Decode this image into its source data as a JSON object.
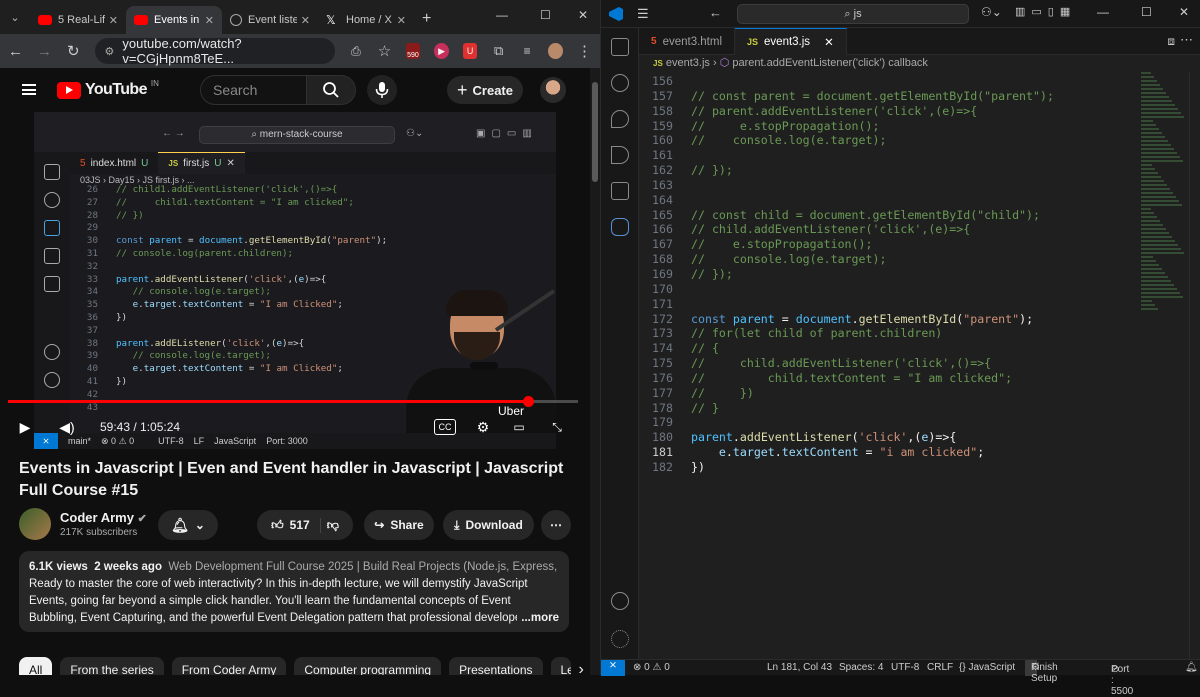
{
  "browser": {
    "tabs": [
      {
        "label": "5 Real-Life",
        "icon": "youtube-icon",
        "active": false
      },
      {
        "label": "Events in J",
        "icon": "youtube-icon",
        "active": true
      },
      {
        "label": "Event lister",
        "icon": "globe-icon",
        "active": false
      },
      {
        "label": "Home / X",
        "icon": "x-icon",
        "active": false
      }
    ],
    "url": "youtube.com/watch?v=CGjHpnm8TeE...",
    "badge_count": "590"
  },
  "youtube": {
    "logo_text": "YouTube",
    "country_code": "IN",
    "search_placeholder": "Search",
    "create_label": "Create",
    "video": {
      "editor_search": "mern-stack-course",
      "tabs": [
        {
          "label": "index.html",
          "flag": "U"
        },
        {
          "label": "first.js",
          "flag": "U"
        }
      ],
      "breadcrumb": "03JS  ›  Day15  ›  JS first.js  ›  ...",
      "code_lines": [
        {
          "n": "26",
          "code": "// child1.addEventListener('click',()=>{"
        },
        {
          "n": "27",
          "code": "//     child1.textContent = \"I am clicked\";"
        },
        {
          "n": "28",
          "code": "// })"
        },
        {
          "n": "29",
          "code": ""
        },
        {
          "n": "30",
          "code": "const parent = document.getElementById(\"parent\");"
        },
        {
          "n": "31",
          "code": "// console.log(parent.children);"
        },
        {
          "n": "32",
          "code": ""
        },
        {
          "n": "33",
          "code": "parent.addEventListener('click',(e)=>{"
        },
        {
          "n": "34",
          "code": "   // console.log(e.target);"
        },
        {
          "n": "35",
          "code": "   e.target.textContent = \"I am Clicked\";"
        },
        {
          "n": "36",
          "code": "})"
        },
        {
          "n": "37",
          "code": ""
        },
        {
          "n": "38",
          "code": "parent.addEListener('click',(e)=>{"
        },
        {
          "n": "39",
          "code": "   // console.log(e.target);"
        },
        {
          "n": "40",
          "code": "   e.target.textContent = \"I am Clicked\";"
        },
        {
          "n": "41",
          "code": "})"
        },
        {
          "n": "42",
          "code": ""
        },
        {
          "n": "43",
          "code": ""
        }
      ],
      "overlay_text": "Uber",
      "time": "59:43 / 1:05:24",
      "progress": 0.913,
      "status": {
        "branch": "main*",
        "problems": "⊗ 0 ⚠ 0",
        "encoding": "UTF-8",
        "eol": "LF",
        "language": "JavaScript",
        "port": "Port: 3000"
      }
    },
    "title": "Events in Javascript | Even and Event handler in Javascript | Javascript Full Course #15",
    "channel": {
      "name": "Coder Army",
      "subscribers": "217K subscribers"
    },
    "actions": {
      "likes": "517",
      "share": "Share",
      "download": "Download"
    },
    "description": {
      "views": "6.1K views",
      "age": "2 weeks ago",
      "tags": "Web Development Full Course 2025 | Build Real Projects (Node.js, Express, React, J",
      "text": "Ready to master the core of web interactivity? In this in-depth lecture, we will demystify JavaScript Events, going far beyond a simple click handler. You'll learn the fundamental concepts of Event Bubbling, Event Capturing, and the powerful Event Delegation pattern that professional developers use to write efficien",
      "more": "...more"
    },
    "chips": [
      "All",
      "From the series",
      "From Coder Army",
      "Computer programming",
      "Presentations",
      "Le"
    ]
  },
  "vscode": {
    "search": "js",
    "tabs": [
      {
        "label": "event3.html",
        "active": false
      },
      {
        "label": "event3.js",
        "active": true
      }
    ],
    "breadcrumb_file": "event3.js",
    "breadcrumb_symbol": "parent.addEventListener('click') callback",
    "current_line": "181",
    "lines": [
      {
        "n": "156",
        "code": ""
      },
      {
        "n": "157",
        "code": "// const parent = document.getElementById(\"parent\");"
      },
      {
        "n": "158",
        "code": "// parent.addEventListener('click',(e)=>{"
      },
      {
        "n": "159",
        "code": "//     e.stopPropagation();"
      },
      {
        "n": "160",
        "code": "//    console.log(e.target);"
      },
      {
        "n": "161",
        "code": ""
      },
      {
        "n": "162",
        "code": "// });"
      },
      {
        "n": "163",
        "code": ""
      },
      {
        "n": "164",
        "code": ""
      },
      {
        "n": "165",
        "code": "// const child = document.getElementById(\"child\");"
      },
      {
        "n": "166",
        "code": "// child.addEventListener('click',(e)=>{"
      },
      {
        "n": "167",
        "code": "//    e.stopPropagation();"
      },
      {
        "n": "168",
        "code": "//    console.log(e.target);"
      },
      {
        "n": "169",
        "code": "// });"
      },
      {
        "n": "170",
        "code": ""
      },
      {
        "n": "171",
        "code": ""
      },
      {
        "n": "172",
        "code": "const parent = document.getElementById(\"parent\");"
      },
      {
        "n": "173",
        "code": "// for(let child of parent.children)"
      },
      {
        "n": "174",
        "code": "// {"
      },
      {
        "n": "175",
        "code": "//     child.addEventListener('click',()=>{"
      },
      {
        "n": "176",
        "code": "//         child.textContent = \"I am clicked\";"
      },
      {
        "n": "177",
        "code": "//     })"
      },
      {
        "n": "178",
        "code": "// }"
      },
      {
        "n": "179",
        "code": ""
      },
      {
        "n": "180",
        "code": "parent.addEventListener('click',(e)=>{"
      },
      {
        "n": "181",
        "code": "    e.target.textContent = \"i am clicked\";"
      },
      {
        "n": "182",
        "code": "})"
      }
    ],
    "status": {
      "errors": "⊗ 0 ⚠ 0",
      "position": "Ln 181, Col 43",
      "spaces": "Spaces: 4",
      "encoding": "UTF-8",
      "eol": "CRLF",
      "language": "{} JavaScript",
      "setup": "Finish Setup",
      "port": "Port : 5500"
    }
  },
  "colors": {
    "youtube_red": "#ff0000",
    "vscode_blue": "#0078d4",
    "comment_green": "#6a9955",
    "string": "#ce9178"
  }
}
